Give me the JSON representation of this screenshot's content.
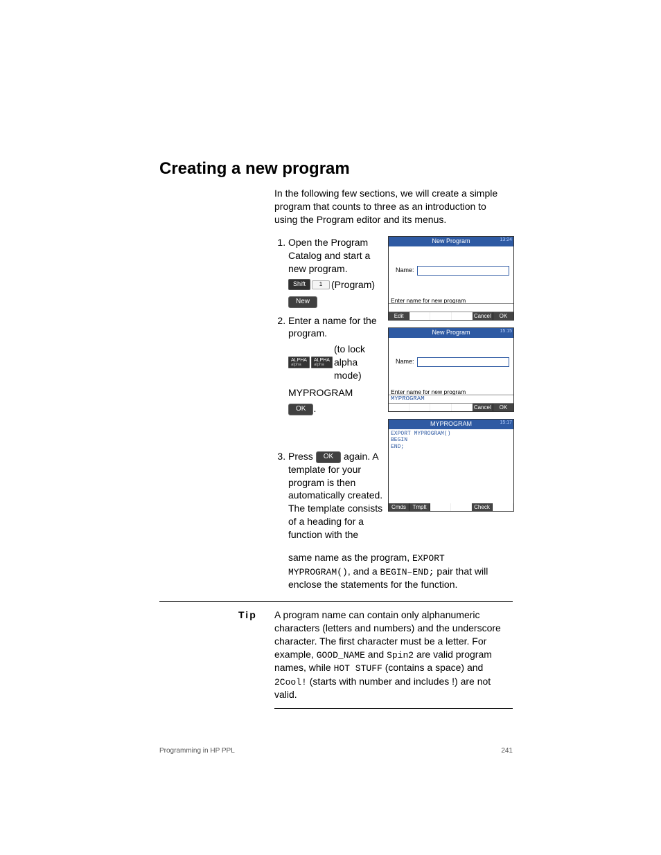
{
  "heading": "Creating a new program",
  "intro": "In the following few sections, we will create a simple program that counts to three as an introduction to using the Program editor and its menus.",
  "steps": {
    "s1": "Open the Program Catalog and start a new program.",
    "s1_program_label": "(Program)",
    "key_shift": "Shift",
    "key_1": "1",
    "key_new": "New",
    "s2": "Enter a name for the program.",
    "key_alpha": "ALPHA",
    "s2_lock": "(to lock alpha mode)",
    "s2_name": "MYPROGRAM",
    "key_ok": "OK",
    "s3_a": "Press ",
    "s3_b": " again. A template for your program is then automatically created. The template consists of a heading for a function with the"
  },
  "shots": {
    "title_newprog": "New Program",
    "title_myprog": "MYPROGRAM",
    "time1": "13:24",
    "time2": "15:15",
    "time3": "15:17",
    "name_label": "Name:",
    "hint": "Enter name for new program",
    "entered": "MYPROGRAM",
    "menu_edit": "Edit",
    "menu_cancel": "Cancel",
    "menu_ok": "OK",
    "menu_cmds": "Cmds",
    "menu_tmplt": "Tmplt",
    "menu_check": "Check",
    "code_l1": "EXPORT MYPROGRAM()",
    "code_l2": "BEGIN",
    "code_l3": "",
    "code_l4": "END;"
  },
  "after": {
    "l1a": "same name as the program, ",
    "c1": "EXPORT MYPROGRAM()",
    "l1b": ", and a ",
    "c2": "BEGIN–END;",
    "l1c": " pair that will enclose the statements for the function."
  },
  "tip": {
    "label": "Tip",
    "t1": "A program name can contain only alphanumeric characters (letters and numbers) and the underscore character. The first character must be a letter. For example, ",
    "c1": "GOOD_NAME",
    "t2": " and ",
    "c2": "Spin2",
    "t3": " are valid program names, while ",
    "c3": "HOT STUFF",
    "t4": " (contains a space) and ",
    "c4": "2Cool!",
    "t5": " (starts with number and includes !) are not valid."
  },
  "footer": {
    "left": "Programming in HP PPL",
    "right": "241"
  }
}
